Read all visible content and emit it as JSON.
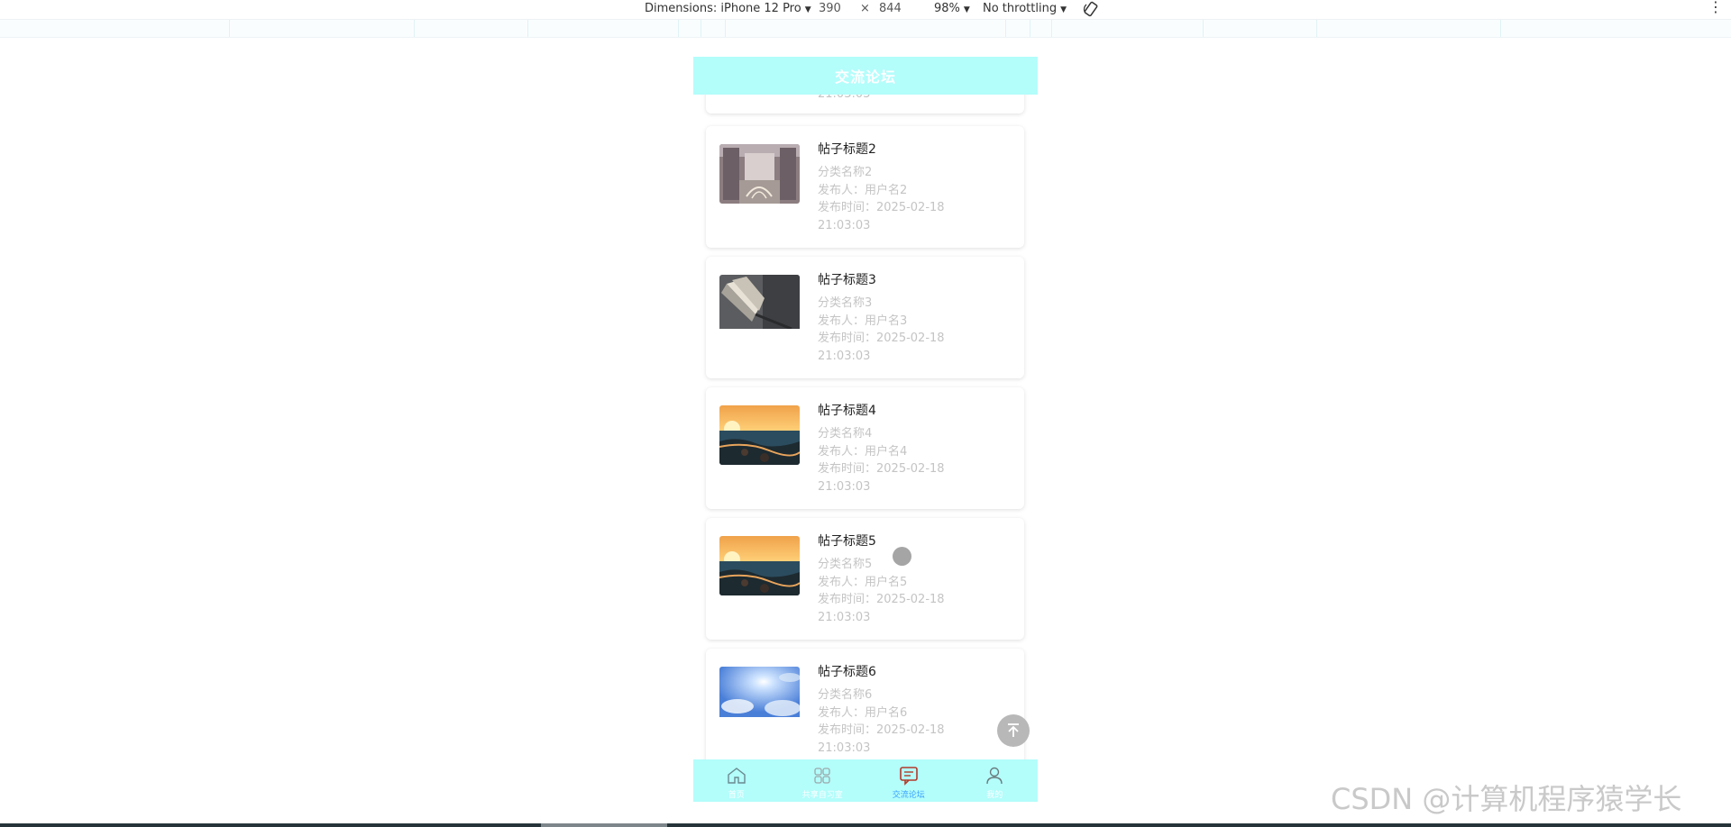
{
  "devtools": {
    "dimensions_label": "Dimensions: iPhone 12 Pro",
    "width": "390",
    "times": "×",
    "height": "844",
    "zoom": "98%",
    "throttling": "No throttling"
  },
  "header": {
    "title": "交流论坛"
  },
  "partial_post": {
    "time_tail": "21:03:03"
  },
  "posts": [
    {
      "title": "帖子标题2",
      "category": "分类名称2",
      "publisher": "发布人：用户名2",
      "time_label": "发布时间：2025-02-18",
      "time_tail": "21:03:03",
      "image": "library-bookshelf"
    },
    {
      "title": "帖子标题3",
      "category": "分类名称3",
      "publisher": "发布人：用户名3",
      "time_label": "发布时间：2025-02-18",
      "time_tail": "21:03:03",
      "image": "open-book"
    },
    {
      "title": "帖子标题4",
      "category": "分类名称4",
      "publisher": "发布人：用户名4",
      "time_label": "发布时间：2025-02-18",
      "time_tail": "21:03:03",
      "image": "sunset-sea"
    },
    {
      "title": "帖子标题5",
      "category": "分类名称5",
      "publisher": "发布人：用户名5",
      "time_label": "发布时间：2025-02-18",
      "time_tail": "21:03:03",
      "image": "sunset-sea"
    },
    {
      "title": "帖子标题6",
      "category": "分类名称6",
      "publisher": "发布人：用户名6",
      "time_label": "发布时间：2025-02-18",
      "time_tail": "21:03:03",
      "image": "blue-sky"
    }
  ],
  "tabbar": {
    "items": [
      {
        "label": "首页",
        "icon": "home-icon"
      },
      {
        "label": "共享自习室",
        "icon": "grid-icon"
      },
      {
        "label": "交流论坛",
        "icon": "chat-icon",
        "active": true
      },
      {
        "label": "我的",
        "icon": "user-icon"
      }
    ]
  },
  "colors": {
    "header_bg": "#b3fdfb",
    "active_tab": "#3aa1ff",
    "meta_text": "#c4c4c4"
  },
  "watermark": "CSDN @计算机程序猿学长"
}
